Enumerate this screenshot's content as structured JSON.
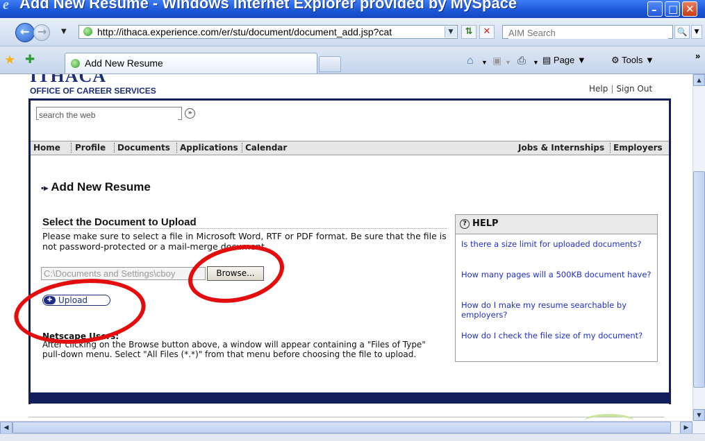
{
  "window": {
    "title": "Add New Resume - Windows Internet Explorer provided by MySpace",
    "minimize_glyph": "–",
    "maximize_glyph": "□",
    "close_glyph": "✕"
  },
  "address_bar": {
    "url": "http://ithaca.experience.com/er/stu/document/document_add.jsp?cat",
    "search_placeholder": "AIM Search"
  },
  "tabs": [
    {
      "label": "Add New Resume",
      "active": true
    }
  ],
  "command_bar": {
    "page_label": "Page",
    "tools_label": "Tools",
    "more": "»"
  },
  "site": {
    "logo_text": "ITHACA",
    "org_name": "OFFICE OF CAREER SERVICES",
    "help_link": "Help",
    "separator": "|",
    "signout_link": "Sign Out",
    "web_search_value": "search the web",
    "web_search_go": "»"
  },
  "nav": {
    "items": [
      "Home",
      "Profile",
      "Documents",
      "Applications",
      "Calendar"
    ],
    "right_items": [
      "Jobs & Internships",
      "Employers"
    ]
  },
  "page": {
    "heading": "Add New Resume",
    "heading_bullet": "▪▸",
    "section_title": "Select the Document to Upload",
    "instructions": "Please make sure to select a file in Microsoft Word, RTF or PDF format. Be sure that the file is not password-protected or a mail-merge document.",
    "file_path": "C:\\Documents and Settings\\cboy",
    "browse_label": "Browse...",
    "upload_label": "Upload",
    "netscape_heading": "Netscape Users:",
    "netscape_text": "After clicking on the Browse button above, a window will appear containing a \"Files of Type\" pull-down menu. Select \"All Files (*.*)\" from that menu before choosing the file to upload."
  },
  "help": {
    "title": "HELP",
    "icon_glyph": "?",
    "links": [
      "Is there a size limit for uploaded documents?",
      "How many pages will a 500KB document have?",
      "How do I make my resume searchable by employers?",
      "How do I check the file size of my document?"
    ]
  },
  "colors": {
    "titlebar": "#1b56d6",
    "site_navy": "#121f5c",
    "link_blue": "#1f2fcc",
    "annotation_red": "#e30d0d"
  }
}
